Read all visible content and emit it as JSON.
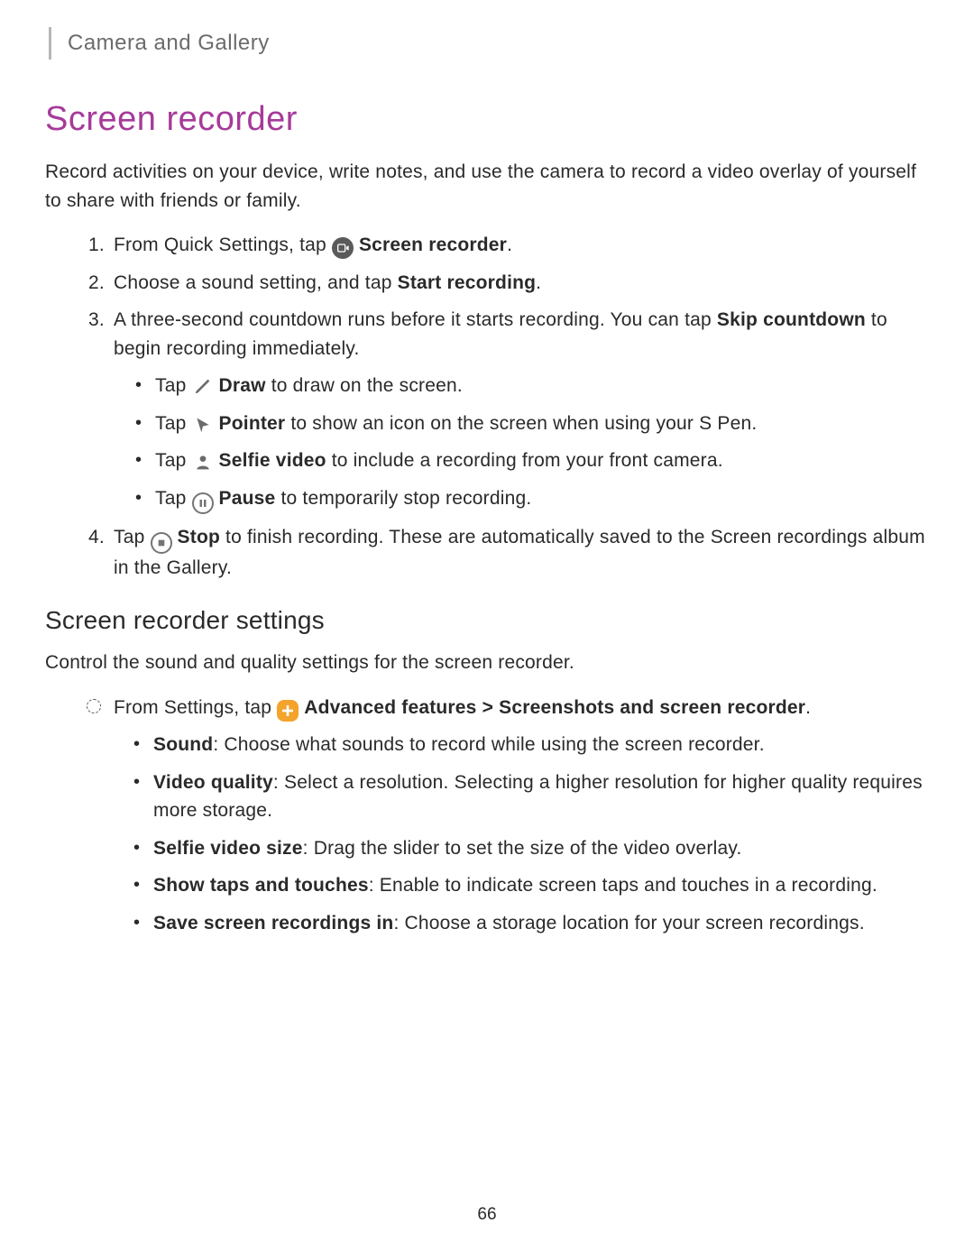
{
  "breadcrumb": "Camera and Gallery",
  "title": "Screen recorder",
  "intro": "Record activities on your device, write notes, and use the camera to record a video overlay of yourself to share with friends or family.",
  "step1_pre": "From Quick Settings, tap ",
  "step1_bold": "Screen recorder",
  "step1_post": ".",
  "step2_pre": "Choose a sound setting, and tap ",
  "step2_bold": "Start recording",
  "step2_post": ".",
  "step3_pre": "A three-second countdown runs before it starts recording. You can tap ",
  "step3_bold": "Skip countdown",
  "step3_post": " to begin recording immediately.",
  "sub_draw_pre": "Tap ",
  "sub_draw_bold": "Draw",
  "sub_draw_post": " to draw on the screen.",
  "sub_pointer_pre": "Tap ",
  "sub_pointer_bold": "Pointer",
  "sub_pointer_post": " to show an icon on the screen when using your S Pen.",
  "sub_selfie_pre": "Tap ",
  "sub_selfie_bold": "Selfie video",
  "sub_selfie_post": " to include a recording from your front camera.",
  "sub_pause_pre": "Tap ",
  "sub_pause_bold": "Pause",
  "sub_pause_post": " to temporarily stop recording.",
  "step4_pre": "Tap ",
  "step4_bold": "Stop",
  "step4_post": " to finish recording. These are automatically saved to the Screen recordings album in the Gallery.",
  "subheading": "Screen recorder settings",
  "subintro": "Control the sound and quality settings for the screen recorder.",
  "settings_from_pre": "From Settings, tap ",
  "settings_from_bold1": "Advanced features",
  "settings_from_gt": " > ",
  "settings_from_bold2": "Screenshots and screen recorder",
  "settings_from_post": ".",
  "opt_sound_bold": "Sound",
  "opt_sound_post": ": Choose what sounds to record while using the screen recorder.",
  "opt_video_bold": "Video quality",
  "opt_video_post": ": Select a resolution. Selecting a higher resolution for higher quality requires more storage.",
  "opt_selfie_bold": "Selfie video size",
  "opt_selfie_post": ": Drag the slider to set the size of the video overlay.",
  "opt_taps_bold": "Show taps and touches",
  "opt_taps_post": ": Enable to indicate screen taps and touches in a recording.",
  "opt_save_bold": "Save screen recordings in",
  "opt_save_post": ": Choose a storage location for your screen recordings.",
  "page_number": "66"
}
